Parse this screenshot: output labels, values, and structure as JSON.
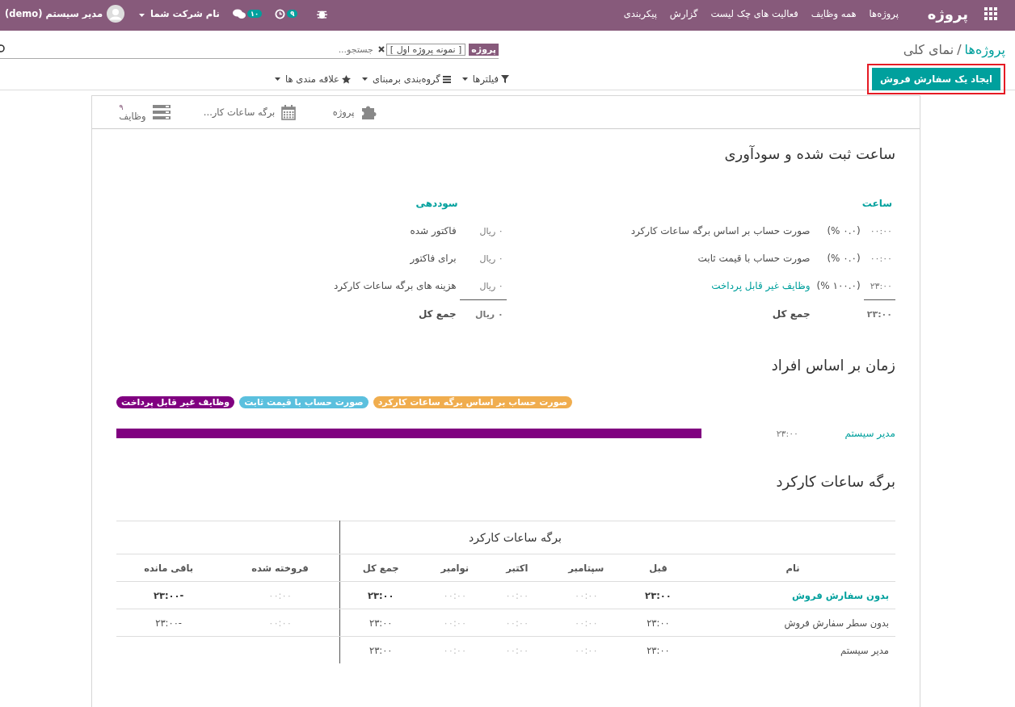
{
  "navbar": {
    "app_title": "پروژه",
    "menu": [
      "پروژه‌ها",
      "همه وظایف",
      "فعالیت های چک لیست",
      "گزارش",
      "پیکربندی"
    ],
    "activities_count": "۹",
    "messages_count": "۱۰",
    "company": "نام شرکت شما",
    "user": "مدیر سیستم (demo)"
  },
  "breadcrumb": {
    "parent": "پروژه‌ها",
    "separator": "/",
    "current": "نمای کلی"
  },
  "search": {
    "facet_label": "پروژه",
    "facet_value": "[ نمونه پروژه اول ]",
    "placeholder": "جستجو..."
  },
  "create_button": {
    "label": "ایجاد یک سفارش فروش",
    "highlighted": true
  },
  "search_options": [
    {
      "kind": "filter",
      "label": "فیلترها"
    },
    {
      "kind": "group",
      "label": "گروه‌بندی برمبنای"
    },
    {
      "kind": "favorite",
      "label": "علاقه مندی ها"
    }
  ],
  "stat_buttons": [
    {
      "kind": "project",
      "label": "پروژه"
    },
    {
      "kind": "timesheet",
      "label": "برگه ساعات کار..."
    },
    {
      "kind": "tasks",
      "label": "وظایف",
      "value": "۹"
    }
  ],
  "hours_section": {
    "title": "ساعت ثبت شده و سودآوری",
    "hours": {
      "header": "ساعت",
      "rows": [
        {
          "value": "۰۰:۰۰",
          "percent": "(۰.۰ %)",
          "label": "صورت حساب بر اساس برگه ساعات کارکرد",
          "link": false
        },
        {
          "value": "۰۰:۰۰",
          "percent": "(۰.۰ %)",
          "label": "صورت حساب با قیمت ثابت",
          "link": false
        },
        {
          "value": "۲۳:۰۰",
          "percent": "(۱۰۰.۰ %)",
          "label": "وظایف غیر قابل پرداخت",
          "link": true
        }
      ],
      "total": "۲۳:۰۰",
      "total_label": "جمع کل"
    },
    "profitability": {
      "header": "سوددهی",
      "rows": [
        {
          "amount": "۰ ریال",
          "label": "فاکتور شده"
        },
        {
          "amount": "۰ ریال",
          "label": "برای فاکتور"
        },
        {
          "amount": "۰ ریال",
          "label": "هزینه های برگه ساعات کارکرد"
        }
      ],
      "total": "۰ ریال",
      "total_label": "جمع کل"
    }
  },
  "people_section": {
    "title": "زمان بر اساس افراد",
    "legend": [
      {
        "label": "صورت حساب بر اساس برگه ساعات کارکرد",
        "color": "#f0ad4e"
      },
      {
        "label": "صورت حساب با قیمت ثابت",
        "color": "#5bc0de"
      },
      {
        "label": "وظایف غیر قابل پرداخت",
        "color": "#800080"
      }
    ],
    "rows": [
      {
        "name": "مدیر سیستم",
        "hours": "۲۳:۰۰",
        "segments": [
          {
            "color": "#800080"
          }
        ]
      }
    ]
  },
  "timesheet_section": {
    "title": "برگه ساعات کارکرد",
    "group_header": "برگه ساعات کارکرد",
    "columns": [
      "نام",
      "قبل",
      "سپتامبر",
      "اکتبر",
      "نوامبر",
      "جمع کل",
      "فروخته شده",
      "باقی مانده"
    ],
    "rows": [
      {
        "kind": "group",
        "cells": [
          "بدون سفارش فروش",
          "۲۳:۰۰",
          "۰۰:۰۰",
          "۰۰:۰۰",
          "۰۰:۰۰",
          "۲۳:۰۰",
          "۰۰:۰۰",
          "-۲۳:۰۰"
        ]
      },
      {
        "kind": "line",
        "cells": [
          "بدون سطر سفارش فروش",
          "۲۳:۰۰",
          "۰۰:۰۰",
          "۰۰:۰۰",
          "۰۰:۰۰",
          "۲۳:۰۰",
          "۰۰:۰۰",
          "-۲۳:۰۰"
        ]
      },
      {
        "kind": "person",
        "cells": [
          "مدیر سیستم",
          "۲۳:۰۰",
          "۰۰:۰۰",
          "۰۰:۰۰",
          "۰۰:۰۰",
          "۲۳:۰۰"
        ]
      }
    ]
  }
}
